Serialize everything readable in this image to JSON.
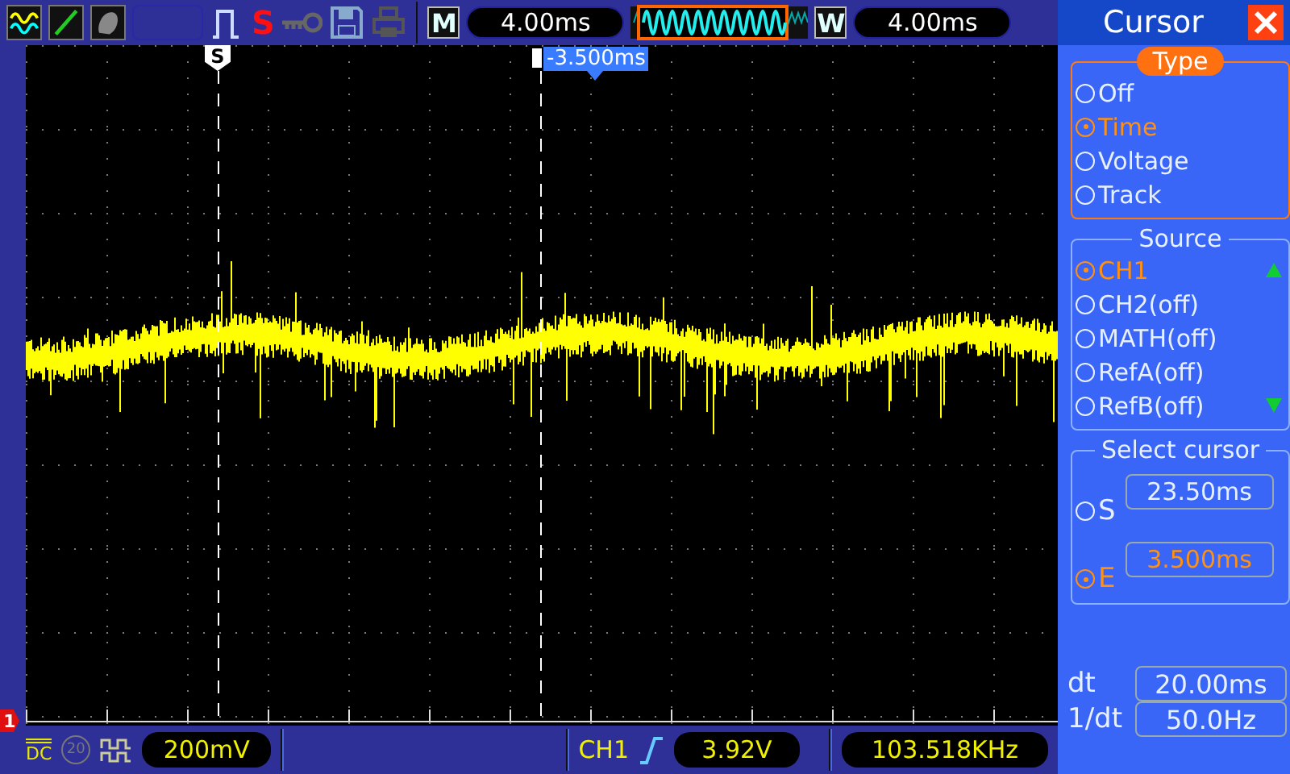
{
  "toolbar": {
    "trigger_flag": "S",
    "mode_label": "M",
    "timebase": "4.00ms",
    "window_label": "W",
    "window_time": "4.00ms"
  },
  "screen": {
    "start_marker": "S",
    "end_readout": "-3.500ms",
    "channel_marker": "1"
  },
  "bottom_bar": {
    "coupling": "DC",
    "bandwidth_limit": "20",
    "volts_per_div": "200mV",
    "trigger_source": "CH1",
    "trigger_level": "3.92V",
    "frequency": "103.518KHz"
  },
  "panel": {
    "title": "Cursor",
    "type": {
      "legend": "Type",
      "options": [
        {
          "label": "Off",
          "selected": false
        },
        {
          "label": "Time",
          "selected": true
        },
        {
          "label": "Voltage",
          "selected": false
        },
        {
          "label": "Track",
          "selected": false
        }
      ]
    },
    "source": {
      "legend": "Source",
      "options": [
        {
          "label": "CH1",
          "selected": true
        },
        {
          "label": "CH2(off)",
          "selected": false
        },
        {
          "label": "MATH(off)",
          "selected": false
        },
        {
          "label": "RefA(off)",
          "selected": false
        },
        {
          "label": "RefB(off)",
          "selected": false
        }
      ]
    },
    "select_cursor": {
      "legend": "Select cursor",
      "cursors": [
        {
          "label": "S",
          "value": "23.50ms",
          "selected": false
        },
        {
          "label": "E",
          "value": "3.500ms",
          "selected": true
        }
      ]
    },
    "dt": {
      "label": "dt",
      "value": "20.00ms"
    },
    "inverse_dt": {
      "label": "1/dt",
      "value": "50.0Hz"
    }
  }
}
